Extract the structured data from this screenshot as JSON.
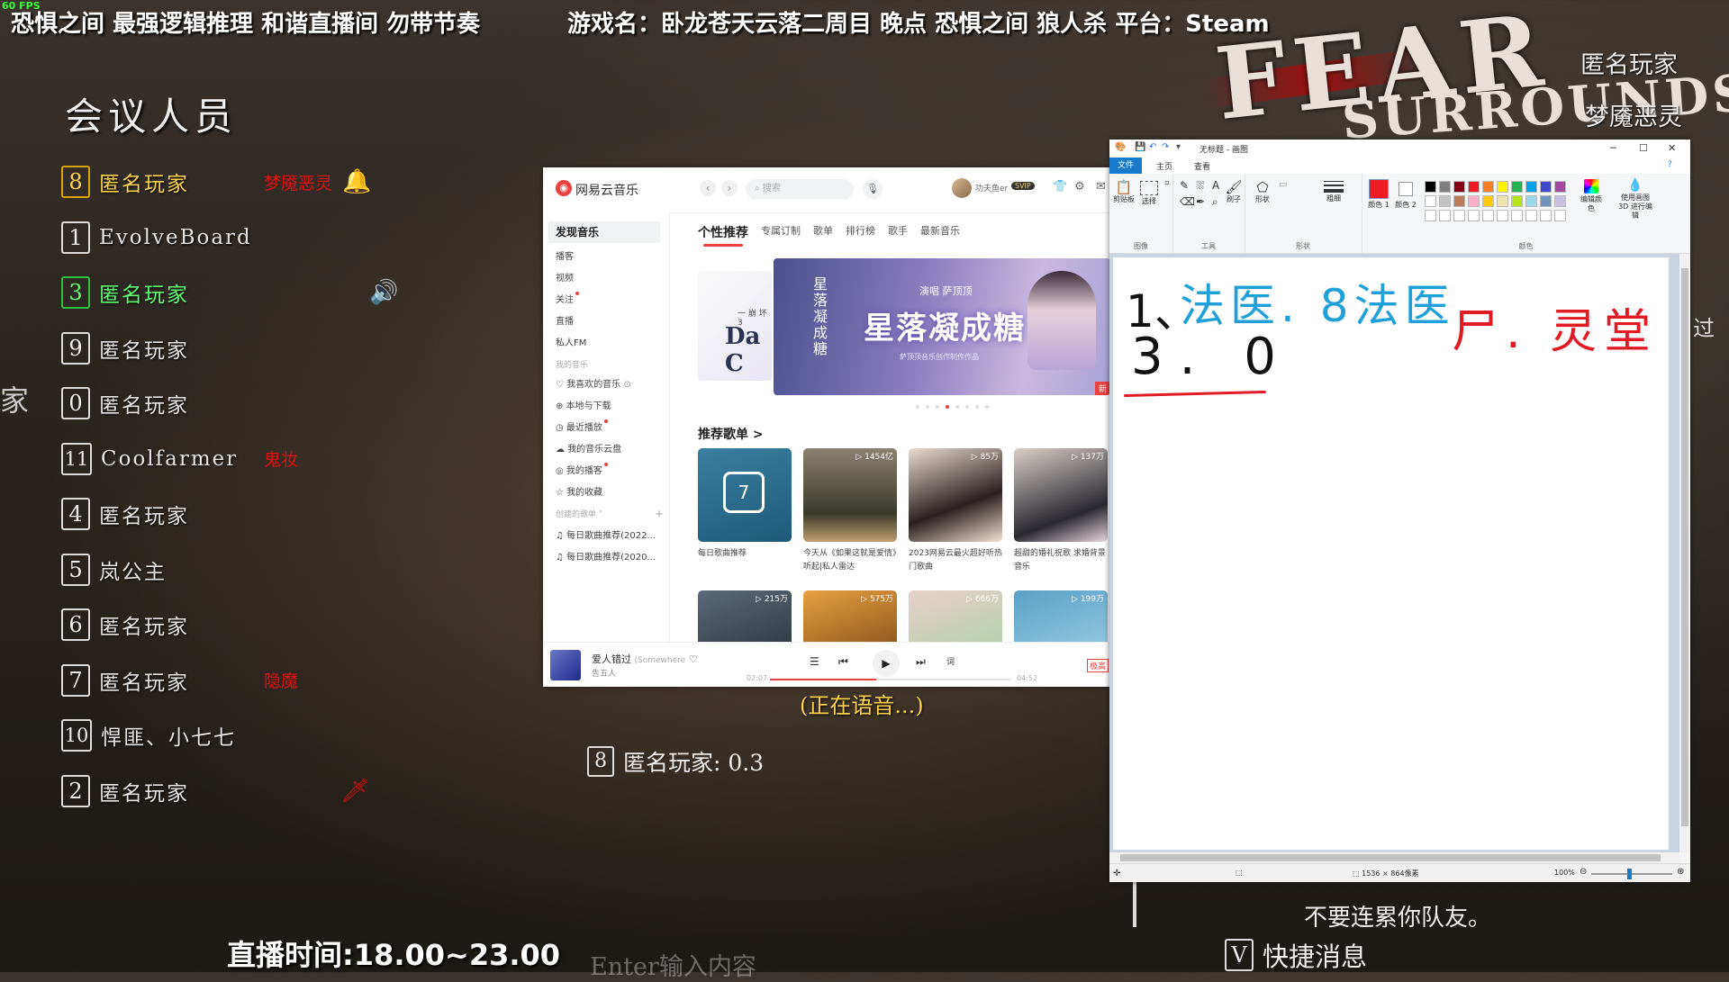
{
  "overlay": {
    "fps": "60 FPS",
    "stream_title": "恐惧之间 最强逻辑推理 和谐直播间 勿带节奏",
    "game_title": "游戏名：卧龙苍天云落二周目 晚点 恐惧之间 狼人杀  平台：Steam",
    "logo_line1": "FEAR",
    "logo_line2": "SURROUNDS",
    "stream_time": "直播时间:18.00~23.00"
  },
  "meeting": {
    "title": "会议人员",
    "players": [
      {
        "num": "8",
        "name": "匿名玩家",
        "role": "梦魇恶灵",
        "style": "gold",
        "icon": "bell-icon"
      },
      {
        "num": "1",
        "name": "EvolveBoard",
        "role": "",
        "style": "normal",
        "icon": ""
      },
      {
        "num": "3",
        "name": "匿名玩家",
        "role": "",
        "style": "green",
        "icon": "speaker-icon"
      },
      {
        "num": "9",
        "name": "匿名玩家",
        "role": "",
        "style": "normal",
        "icon": ""
      },
      {
        "num": "0",
        "name": "匿名玩家",
        "role": "",
        "style": "normal",
        "icon": ""
      },
      {
        "num": "11",
        "name": "Coolfarmer",
        "role": "鬼妆",
        "style": "normal",
        "icon": ""
      },
      {
        "num": "4",
        "name": "匿名玩家",
        "role": "",
        "style": "normal",
        "icon": ""
      },
      {
        "num": "5",
        "name": "岚公主",
        "role": "",
        "style": "normal",
        "icon": ""
      },
      {
        "num": "6",
        "name": "匿名玩家",
        "role": "",
        "style": "normal",
        "icon": ""
      },
      {
        "num": "7",
        "name": "匿名玩家",
        "role": "隐魔",
        "style": "normal",
        "icon": ""
      },
      {
        "num": "10",
        "name": "悍匪、小七七",
        "role": "",
        "style": "normal",
        "icon": ""
      },
      {
        "num": "2",
        "name": "匿名玩家",
        "role": "",
        "style": "normal",
        "icon": "knife-icon"
      }
    ]
  },
  "game": {
    "voice_status": "(正在语音...)",
    "vote_num": "8",
    "vote_text": "匿名玩家: 0.3",
    "chat_placeholder": "Enter输入内容",
    "chat_line": "不要连累你队友。",
    "quick_key": "V",
    "quick_label": "快捷消息",
    "right_player_1": "匿名玩家",
    "right_player_2": "梦魇恶灵",
    "right_edge": "过",
    "left_edge": "家"
  },
  "music": {
    "app_name": "网易云音乐",
    "search_placeholder": "搜索",
    "user_name": "功夫鱼er",
    "vip": "SVIP",
    "sidebar": {
      "active": "发现音乐",
      "items": [
        "播客",
        "视频",
        "关注",
        "直播",
        "私人FM"
      ],
      "my_music_head": "我的音乐",
      "my_items": [
        "我喜欢的音乐",
        "本地与下载",
        "最近播放",
        "我的音乐云盘",
        "我的播客",
        "我的收藏"
      ],
      "created_head": "创建的歌单",
      "playlists": [
        "每日歌曲推荐(2022...",
        "每日歌曲推荐(2020..."
      ]
    },
    "tabs": [
      "个性推荐",
      "专属订制",
      "歌单",
      "排行榜",
      "歌手",
      "最新音乐"
    ],
    "banner_left_title": "Da C",
    "banner_left_sub": "一 崩 坏 3",
    "banner": {
      "singer": "演唱 萨顶顶",
      "title": "星落凝成糖",
      "vertical": "星落凝成糖",
      "subtitle": "萨顶顶音乐创作制作作品",
      "badge": "新"
    },
    "section_title": "推荐歌单 >",
    "cards": [
      {
        "count": "",
        "caption": "每日歌曲推荐",
        "calendar": "7"
      },
      {
        "count": "▷ 1454亿",
        "caption": "今天从《如果这就是爱情》听起|私人雷达"
      },
      {
        "count": "▷ 85万",
        "caption": "2023网易云最火超好听热门歌曲"
      },
      {
        "count": "▷ 137万",
        "caption": "超甜的婚礼祝歌 求婚背景音乐"
      },
      {
        "count": "▷ 215万",
        "caption": ""
      },
      {
        "count": "▷ 575万",
        "caption": ""
      },
      {
        "count": "▷ 666万",
        "caption": ""
      },
      {
        "count": "▷ 199万",
        "caption": ""
      }
    ],
    "player": {
      "song": "爱人错过",
      "song_extra": "(Somewhere",
      "artist": "告五人",
      "time_current": "02:07",
      "time_total": "04:52",
      "progress": 0.44,
      "lyric_btn": "词",
      "hq": "极高"
    }
  },
  "paint": {
    "title": "无标题 - 画图",
    "menu": [
      "文件",
      "主页",
      "查看"
    ],
    "groups": [
      "图像",
      "工具",
      "形状",
      "颜色"
    ],
    "tool_labels": {
      "paste": "剪贴板",
      "select": "选择",
      "brush": "刷子",
      "shapes": "形状",
      "size": "粗细",
      "color1": "颜色 1",
      "color2": "颜色 2",
      "edit_colors": "编辑颜色",
      "paint3d": "使用画图 3D 进行编辑"
    },
    "palette": [
      "#000000",
      "#7f7f7f",
      "#880015",
      "#ed1c24",
      "#ff7f27",
      "#fff200",
      "#22b14c",
      "#00a2e8",
      "#3f48cc",
      "#a349a4",
      "#ffffff",
      "#c3c3c3",
      "#b97a57",
      "#ffaec9",
      "#ffc90e",
      "#efe4b0",
      "#b5e61d",
      "#99d9ea",
      "#7092be",
      "#c8bfe7"
    ],
    "color1": "#ed1c24",
    "handwriting": {
      "line1_black": "1、",
      "line1_blue": "法医. 8法医",
      "line2": "3. 0",
      "red": "尸. 灵堂"
    },
    "status_size": "1536 × 864像素",
    "zoom": "100%"
  }
}
